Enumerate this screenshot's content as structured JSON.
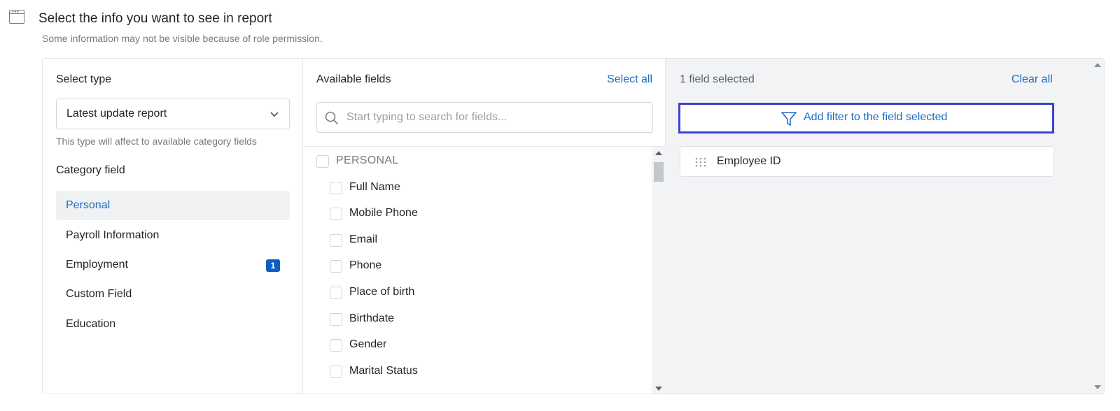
{
  "header": {
    "title": "Select the info you want to see in report",
    "subtitle": "Some information may not be visible because of role permission."
  },
  "type_panel": {
    "label": "Select type",
    "selected_type": "Latest update report",
    "hint": "This type will affect to available category fields",
    "category_label": "Category field",
    "categories": [
      {
        "label": "Personal",
        "active": true,
        "badge": ""
      },
      {
        "label": "Payroll Information",
        "active": false,
        "badge": ""
      },
      {
        "label": "Employment",
        "active": false,
        "badge": "1"
      },
      {
        "label": "Custom Field",
        "active": false,
        "badge": ""
      },
      {
        "label": "Education",
        "active": false,
        "badge": ""
      }
    ]
  },
  "fields_panel": {
    "title": "Available fields",
    "select_all_label": "Select all",
    "search_placeholder": "Start typing to search for fields...",
    "group_label": "PERSONAL",
    "fields": [
      "Full Name",
      "Mobile Phone",
      "Email",
      "Phone",
      "Place of birth",
      "Birthdate",
      "Gender",
      "Marital Status"
    ]
  },
  "selected_panel": {
    "count_label": "1 field selected",
    "clear_all_label": "Clear all",
    "add_filter_label": "Add filter to the field selected",
    "selected_fields": [
      "Employee ID"
    ]
  },
  "colors": {
    "accent": "#1d6bc4",
    "focus_border": "#3a44d4",
    "badge": "#0f5fc2"
  }
}
